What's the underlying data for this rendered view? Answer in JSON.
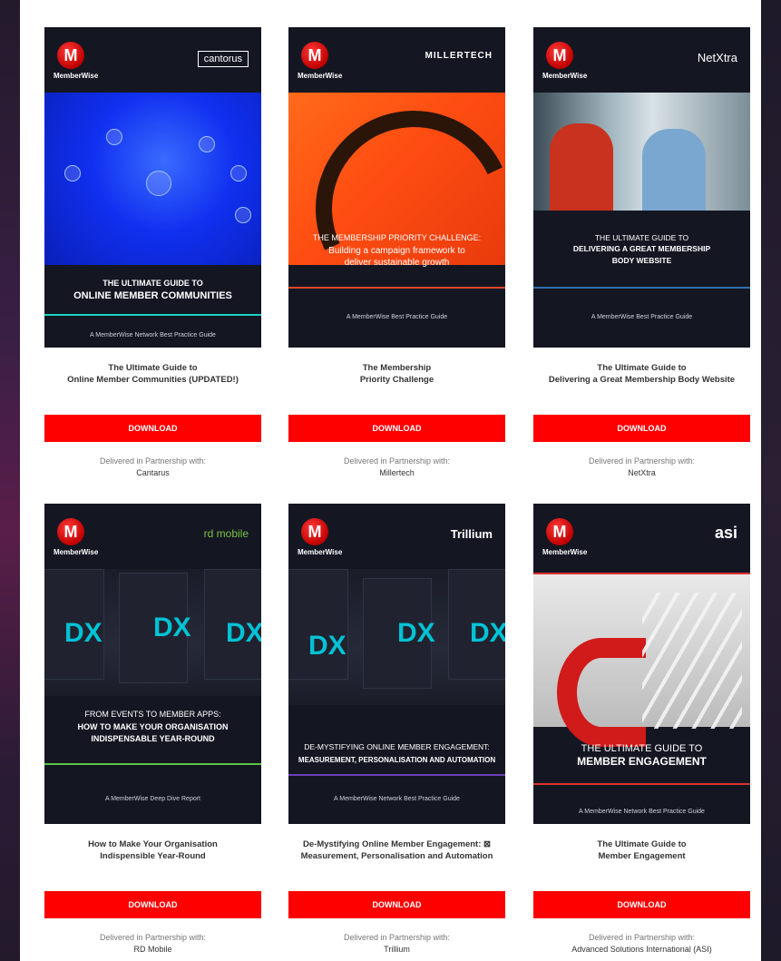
{
  "download_label": "DOWNLOAD",
  "partner_prefix": "Delivered in Partnership with:",
  "brand": {
    "logo_letter": "M",
    "logo_text": "MemberWise",
    "accent": "#ff0000"
  },
  "cards": [
    {
      "partner_logo": "cantorus",
      "cover_title_1": "THE ULTIMATE GUIDE TO",
      "cover_title_2": "ONLINE MEMBER COMMUNITIES",
      "cover_foot": "A MemberWise Network Best Practice Guide",
      "title_1": "The Ultimate Guide to",
      "title_2": "Online Member Communities (UPDATED!)",
      "partner": "Cantarus"
    },
    {
      "partner_logo": "MILLERTECH",
      "cover_title_1": "THE MEMBERSHIP PRIORITY CHALLENGE:",
      "cover_title_2": "Building a campaign framework to deliver sustainable growth",
      "cover_foot": "A MemberWise Best Practice Guide",
      "title_1": "The Membership",
      "title_2": "Priority Challenge",
      "partner": "Millertech"
    },
    {
      "partner_logo": "NetXtra",
      "cover_title_1": "THE ULTIMATE GUIDE TO",
      "cover_title_2": "DELIVERING A GREAT MEMBERSHIP BODY WEBSITE",
      "cover_foot": "A MemberWise Best Practice Guide",
      "title_1": "The Ultimate Guide to",
      "title_2": "Delivering a Great Membership Body Website",
      "partner": "NetXtra"
    },
    {
      "partner_logo": "rd mobile",
      "cover_title_1": "FROM EVENTS TO MEMBER APPS:",
      "cover_title_2": "HOW TO MAKE YOUR ORGANISATION INDISPENSABLE YEAR-ROUND",
      "cover_foot": "A MemberWise Deep Dive Report",
      "title_1": "How to Make Your Organisation",
      "title_2": "Indispensible Year-Round",
      "partner": "RD Mobile"
    },
    {
      "partner_logo": "Trillium",
      "cover_title_1": "DE-MYSTIFYING ONLINE MEMBER ENGAGEMENT:",
      "cover_title_2": "MEASUREMENT, PERSONALISATION AND AUTOMATION",
      "cover_foot": "A MemberWise Network Best Practice Guide",
      "title_1": "De-Mystifying Online Member Engagement: ⊠",
      "title_2": "Measurement, Personalisation and Automation",
      "partner": "Trillium"
    },
    {
      "partner_logo": "asi",
      "cover_title_1": "THE ULTIMATE GUIDE TO",
      "cover_title_2": "MEMBER ENGAGEMENT",
      "cover_foot": "A MemberWise Network Best Practice Guide",
      "title_1": "The Ultimate Guide to",
      "title_2": "Member Engagement",
      "partner": "Advanced Solutions International (ASI)"
    }
  ]
}
